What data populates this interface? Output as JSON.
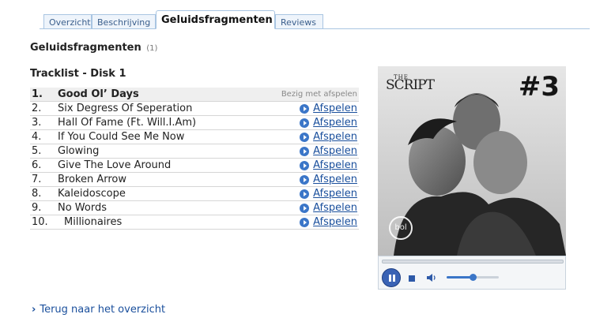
{
  "tabs": [
    {
      "label": "Overzicht"
    },
    {
      "label": "Beschrijving"
    },
    {
      "label": "Geluidsfragmenten"
    },
    {
      "label": "Reviews"
    }
  ],
  "section": {
    "title": "Geluidsfragmenten",
    "count": "(1)"
  },
  "disk": {
    "title": "Tracklist - Disk 1"
  },
  "tracks": [
    {
      "num": "1.",
      "title": "Good Ol’ Days",
      "status": "Bezig met afspelen"
    },
    {
      "num": "2.",
      "title": "Six Degress Of Seperation",
      "action": "Afspelen"
    },
    {
      "num": "3.",
      "title": "Hall Of Fame (Ft. Will.I.Am)",
      "action": "Afspelen"
    },
    {
      "num": "4.",
      "title": "If You Could See Me Now",
      "action": "Afspelen"
    },
    {
      "num": "5.",
      "title": "Glowing",
      "action": "Afspelen"
    },
    {
      "num": "6.",
      "title": "Give The Love Around",
      "action": "Afspelen"
    },
    {
      "num": "7.",
      "title": "Broken Arrow",
      "action": "Afspelen"
    },
    {
      "num": "8.",
      "title": "Kaleidoscope",
      "action": "Afspelen"
    },
    {
      "num": "9.",
      "title": "No Words",
      "action": "Afspelen"
    },
    {
      "num": "10.",
      "title": " Millionaires",
      "action": "Afspelen"
    }
  ],
  "cover": {
    "band": "SCRIPT",
    "band_prefix": "THE",
    "number": "#3",
    "watermark": "bol"
  },
  "player": {
    "state": "playing",
    "volume": 0.5
  },
  "back_link": {
    "label": "Terug naar het overzicht"
  },
  "colors": {
    "link": "#1a4f9c",
    "tab_border": "#a9c5e2",
    "play_icon": "#3b76c8"
  }
}
